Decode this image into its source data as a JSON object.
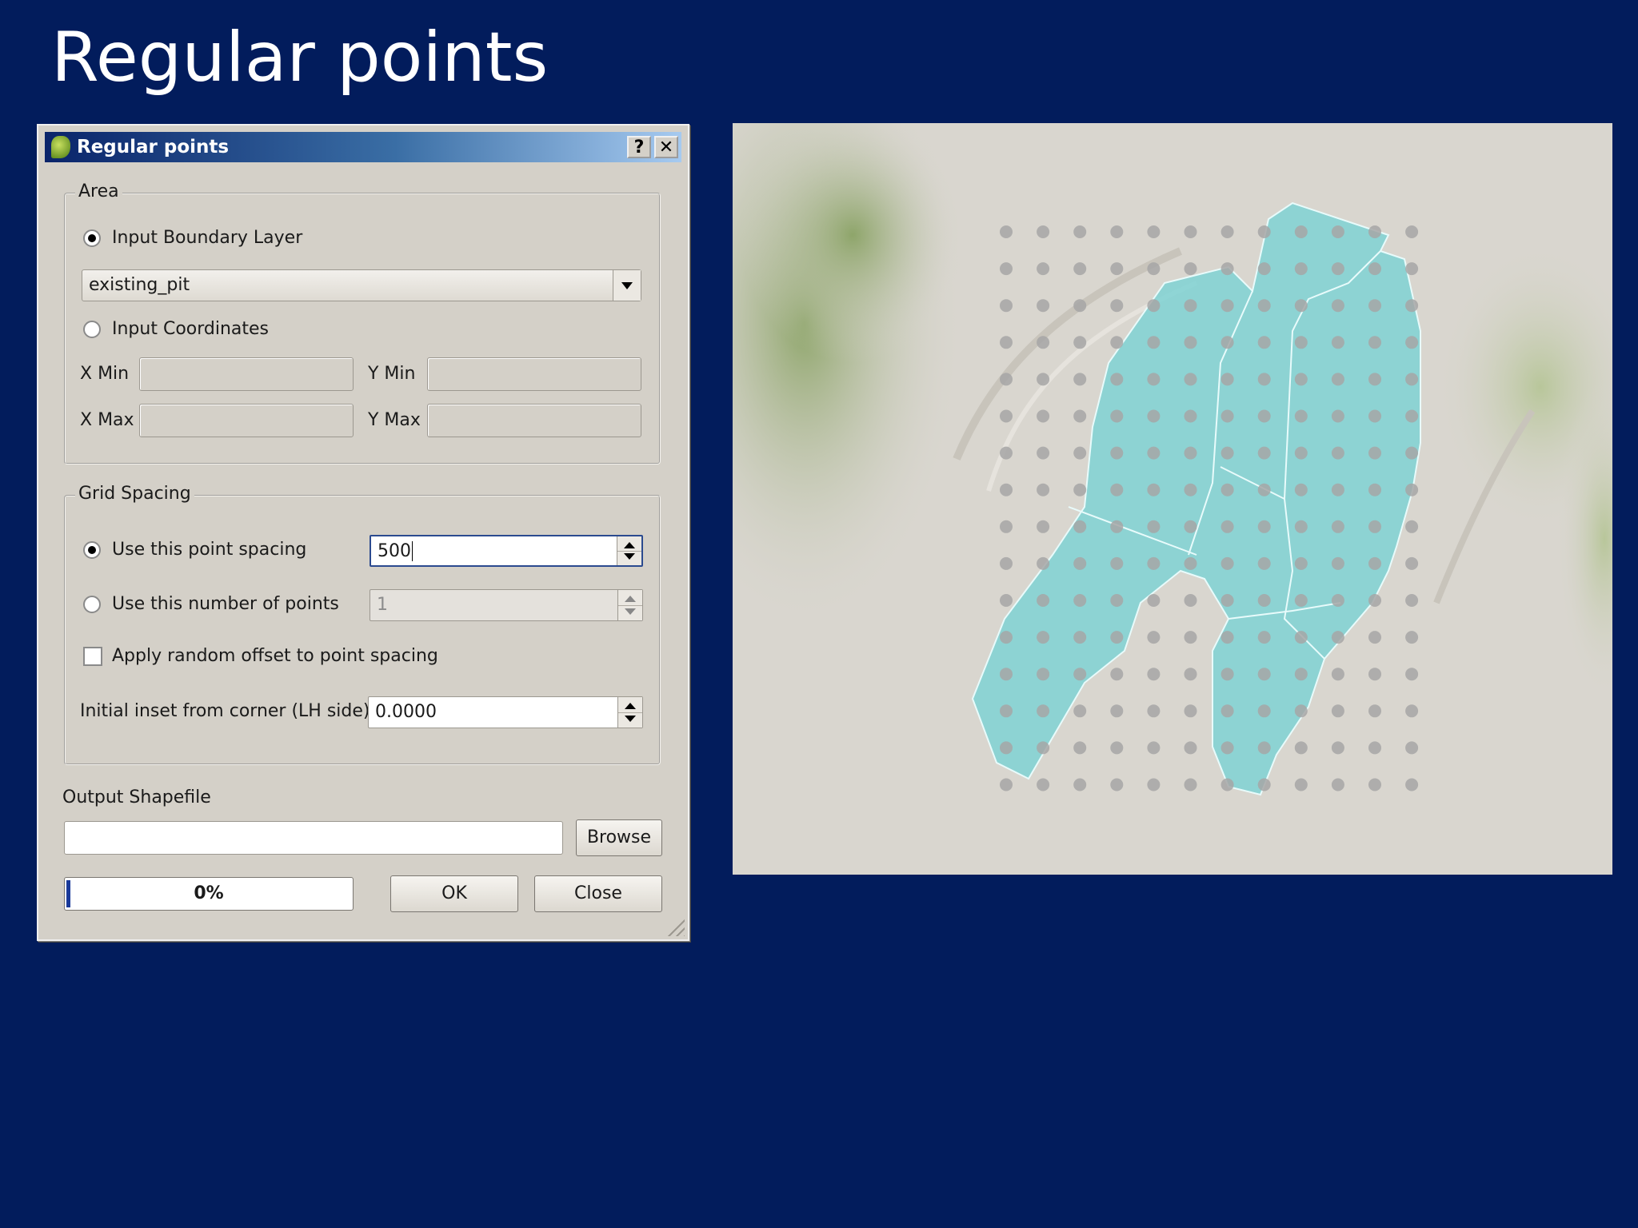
{
  "slide": {
    "title": "Regular points"
  },
  "dialog": {
    "title": "Regular points",
    "help_button": "?",
    "close_x": "✕",
    "area": {
      "legend": "Area",
      "input_boundary_layer_label": "Input Boundary Layer",
      "input_boundary_layer_checked": true,
      "layer_value": "existing_pit",
      "input_coordinates_label": "Input Coordinates",
      "xmin_label": "X Min",
      "ymin_label": "Y Min",
      "xmax_label": "X Max",
      "ymax_label": "Y Max"
    },
    "grid_spacing": {
      "legend": "Grid Spacing",
      "use_spacing_label": "Use this point spacing",
      "spacing_value": "500",
      "use_number_label": "Use this number of points",
      "number_value": "1",
      "random_offset_label": "Apply random offset to point spacing",
      "inset_label": "Initial inset from corner (LH side)",
      "inset_value": "0.0000"
    },
    "output": {
      "label": "Output Shapefile",
      "value": "",
      "browse_label": "Browse"
    },
    "progress": {
      "text": "0%",
      "value": 0
    },
    "ok_label": "OK",
    "close_label": "Close"
  },
  "map": {
    "polygon_fill": "#7fd2d4",
    "point_color": "#a0a0a0",
    "background": "#d9d6cf"
  }
}
